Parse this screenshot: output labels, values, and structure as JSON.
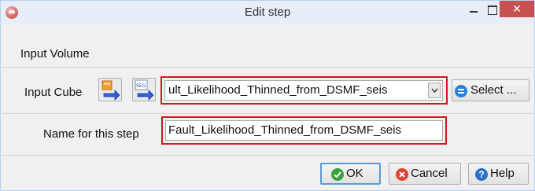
{
  "window": {
    "title": "Edit step",
    "close_glyph": "✕"
  },
  "section": {
    "label": "Input Volume"
  },
  "input_cube": {
    "label": "Input Cube",
    "value": "ult_Likelihood_Thinned_from_DSMF_seis",
    "import_icon": "import-arrow-icon",
    "segy_icon": "segy-import-icon",
    "select_label": "Select ...",
    "select_icon": "list-icon"
  },
  "step_name": {
    "label": "Name for this step",
    "value": "Fault_Likelihood_Thinned_from_DSMF_seis"
  },
  "buttons": {
    "ok": "OK",
    "cancel": "Cancel",
    "help": "Help",
    "help_glyph": "?"
  },
  "colors": {
    "highlight_frame": "#d8141e",
    "close_button": "#c75050",
    "ok_icon": "#3aa23a",
    "cancel_icon": "#e3422e",
    "help_icon": "#2a72c8"
  }
}
